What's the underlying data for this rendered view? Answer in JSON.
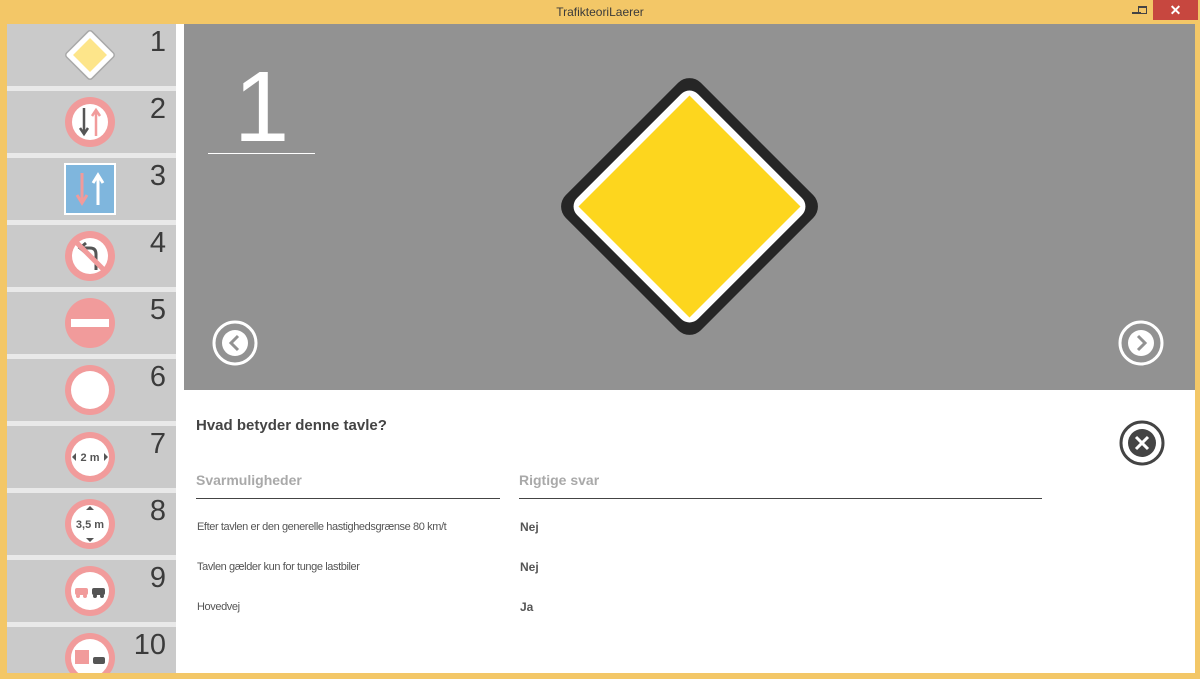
{
  "window": {
    "title": "TrafikteoriLaerer",
    "close_glyph": "✕"
  },
  "sidebar": {
    "items": [
      {
        "number": "1",
        "icon": "priority-road-sign-icon"
      },
      {
        "number": "2",
        "icon": "yield-oncoming-traffic-sign-icon"
      },
      {
        "number": "3",
        "icon": "priority-over-oncoming-traffic-sign-icon"
      },
      {
        "number": "4",
        "icon": "no-u-turn-sign-icon"
      },
      {
        "number": "5",
        "icon": "no-entry-sign-icon"
      },
      {
        "number": "6",
        "icon": "no-vehicles-sign-icon"
      },
      {
        "number": "7",
        "icon": "max-width-sign-icon",
        "label": "2 m"
      },
      {
        "number": "8",
        "icon": "max-height-sign-icon",
        "label": "3,5 m"
      },
      {
        "number": "9",
        "icon": "no-overtaking-sign-icon"
      },
      {
        "number": "10",
        "icon": "no-overtaking-trucks-sign-icon"
      }
    ]
  },
  "hero": {
    "number": "1",
    "sign_icon": "priority-road-sign-icon"
  },
  "question": {
    "title": "Hvad betyder denne tavle?",
    "col_options": "Svarmuligheder",
    "col_answers": "Rigtige svar",
    "rows": [
      {
        "text": "Efter tavlen er den generelle hastighedsgrænse 80 km/t",
        "answer": "Nej"
      },
      {
        "text": "Tavlen gælder kun for tunge lastbiler",
        "answer": "Nej"
      },
      {
        "text": "Hovedvej",
        "answer": "Ja"
      }
    ]
  },
  "colors": {
    "frame": "#f3c767",
    "hero_bg": "#929292",
    "sign_yellow": "#fdd61e",
    "sign_red": "#f19b9b",
    "sign_blue": "#7fb6dd",
    "titlebar_close": "#c7473f"
  }
}
